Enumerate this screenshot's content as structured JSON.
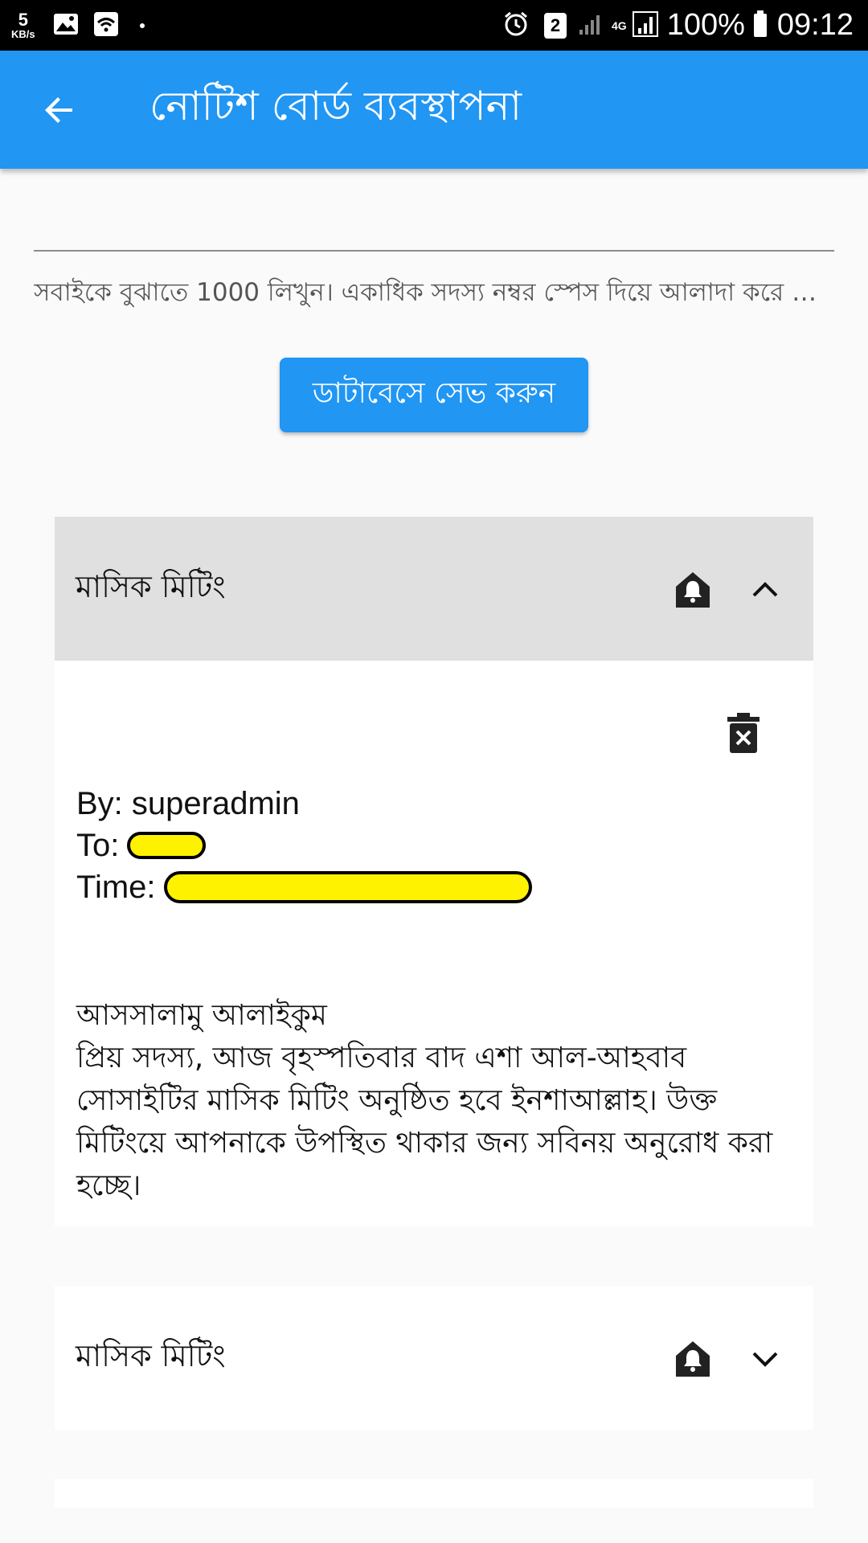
{
  "status_bar": {
    "speed_value": "5",
    "speed_unit": "KB/s",
    "sim_slot": "2",
    "network": "4G",
    "battery": "100%",
    "time": "09:12"
  },
  "app_bar": {
    "title": "নোটিশ বোর্ড ব্যবস্থাপনা"
  },
  "input": {
    "helper": "সবাইকে বুঝাতে 1000 লিখুন। একাধিক সদস্য নম্বর স্পেস দিয়ে আলাদা করে লিখুন"
  },
  "save_button": {
    "label": "ডাটাবেসে সেভ করুন"
  },
  "notices": [
    {
      "title": "মাসিক মিটিং",
      "expanded": true,
      "by_label": "By: superadmin",
      "to_label": "To:",
      "time_label": "Time:",
      "message": "আসসালামু আলাইকুম\nপ্রিয় সদস্য, আজ বৃহস্পতিবার বাদ এশা আল-আহবাব সোসাইটির মাসিক মিটিং অনুষ্ঠিত হবে ইনশাআল্লাহ। উক্ত মিটিংয়ে আপনাকে উপস্থিত থাকার জন্য সবিনয় অনুরোধ করা হচ্ছে।"
    },
    {
      "title": "মাসিক মিটিং",
      "expanded": false
    }
  ],
  "colors": {
    "primary": "#2196f3",
    "expanded_header": "#e0e0e0",
    "redaction": "#fff200"
  }
}
